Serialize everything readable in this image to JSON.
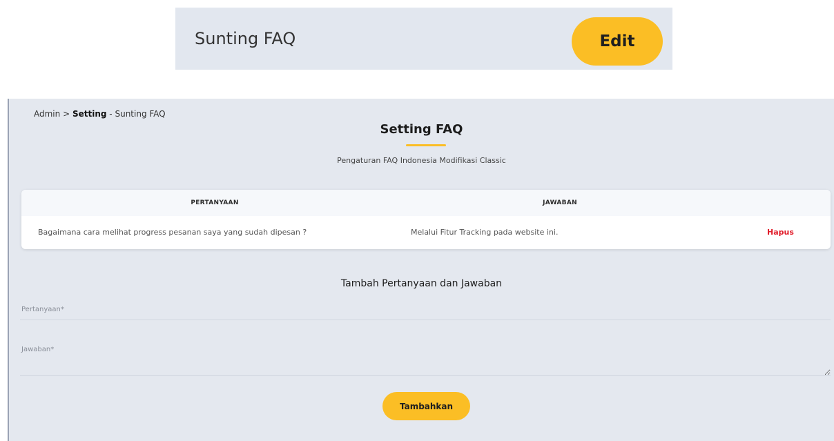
{
  "top_card": {
    "title": "Sunting FAQ",
    "edit_label": "Edit"
  },
  "breadcrumb": {
    "root": "Admin",
    "separator": ">",
    "section": "Setting",
    "dash": "-",
    "current": "Sunting FAQ"
  },
  "page": {
    "title": "Setting FAQ",
    "subtitle": "Pengaturan FAQ Indonesia Modifikasi Classic"
  },
  "faq_table": {
    "headers": {
      "question": "PERTANYAAN",
      "answer": "JAWABAN"
    },
    "rows": [
      {
        "question": "Bagaimana cara melihat progress pesanan saya yang sudah dipesan ?",
        "answer": "Melalui Fitur Tracking pada website ini.",
        "delete_label": "Hapus"
      }
    ]
  },
  "form": {
    "title": "Tambah Pertanyaan dan Jawaban",
    "question_placeholder": "Pertanyaan*",
    "answer_placeholder": "Jawaban*",
    "submit_label": "Tambahkan"
  },
  "colors": {
    "accent": "#fbbe25",
    "panel_bg": "#e4e8ef",
    "danger": "#e11d2a"
  }
}
